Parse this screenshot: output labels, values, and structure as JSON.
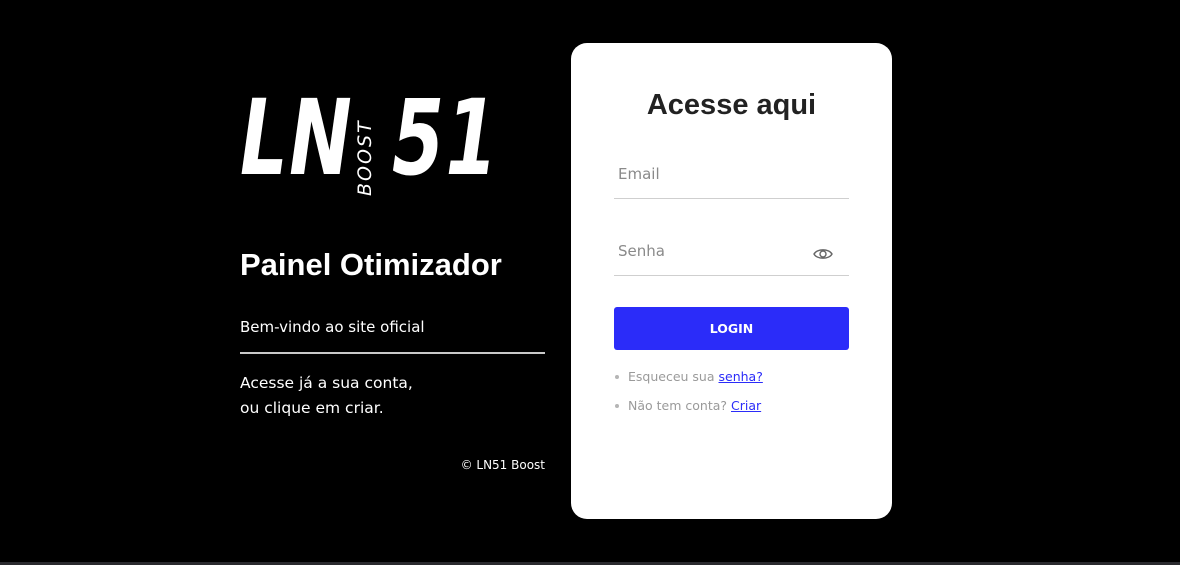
{
  "brand": {
    "logo_main_left": "LN",
    "logo_vertical": "BOOST",
    "logo_main_right": "51"
  },
  "left_panel": {
    "title": "Painel Otimizador",
    "welcome": "Bem-vindo ao site oficial",
    "description_line1": "Acesse já a sua conta,",
    "description_line2": "ou clique em criar.",
    "copyright": "© LN51 Boost"
  },
  "login_card": {
    "title": "Acesse aqui",
    "email": {
      "placeholder": "Email",
      "value": ""
    },
    "password": {
      "placeholder": "Senha",
      "value": "",
      "toggle_icon": "eye-icon"
    },
    "login_button": "LOGIN",
    "forgot_prefix": "Esqueceu sua",
    "forgot_link": "senha?",
    "signup_prefix": "Não tem conta?",
    "signup_link": "Criar"
  },
  "colors": {
    "background": "#000000",
    "card": "#ffffff",
    "accent": "#2b2cf9",
    "text_muted": "#9a9a9a"
  }
}
